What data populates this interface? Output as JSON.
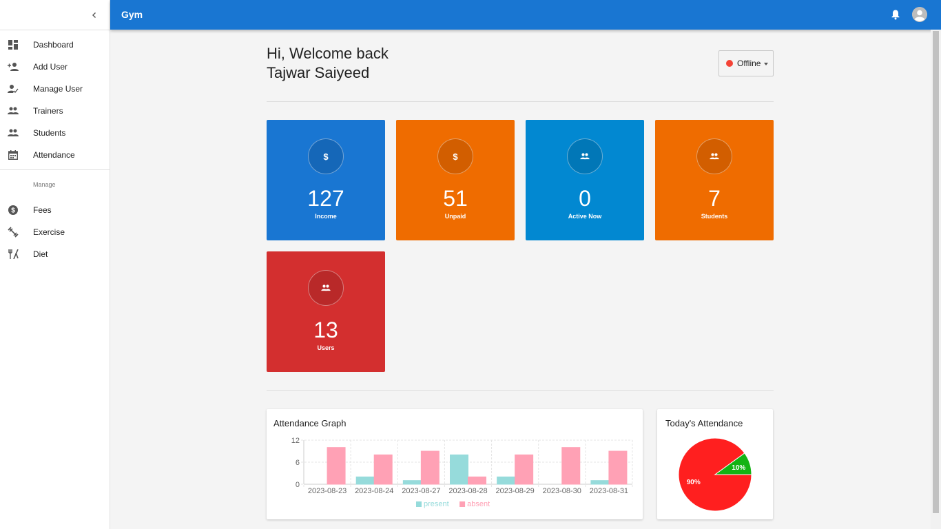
{
  "app": {
    "title": "Gym"
  },
  "sidebar": {
    "items": [
      {
        "label": "Dashboard",
        "icon": "dashboard-icon"
      },
      {
        "label": "Add User",
        "icon": "person-add-icon"
      },
      {
        "label": "Manage User",
        "icon": "person-check-icon"
      },
      {
        "label": "Trainers",
        "icon": "group-icon"
      },
      {
        "label": "Students",
        "icon": "group-icon"
      },
      {
        "label": "Attendance",
        "icon": "calendar-icon"
      }
    ],
    "section_label": "Manage",
    "manage_items": [
      {
        "label": "Fees",
        "icon": "dollar-circle-icon"
      },
      {
        "label": "Exercise",
        "icon": "fitness-icon"
      },
      {
        "label": "Diet",
        "icon": "restaurant-icon"
      }
    ]
  },
  "greeting": {
    "line1": "Hi, Welcome back",
    "line2": "Tajwar Saiyeed"
  },
  "status": {
    "label": "Offline",
    "color": "#f44336"
  },
  "stats": [
    {
      "value": "127",
      "label": "Income",
      "icon": "dollar-icon",
      "color": "#1976d2"
    },
    {
      "value": "51",
      "label": "Unpaid",
      "icon": "dollar-icon",
      "color": "#ef6c00"
    },
    {
      "value": "0",
      "label": "Active Now",
      "icon": "group-icon",
      "color": "#0288d1"
    },
    {
      "value": "7",
      "label": "Students",
      "icon": "group-icon",
      "color": "#ef6c00"
    },
    {
      "value": "13",
      "label": "Users",
      "icon": "group-icon",
      "color": "#d32f2f"
    }
  ],
  "attendance_graph": {
    "title": "Attendance Graph"
  },
  "todays_attendance": {
    "title": "Today's Attendance"
  },
  "chart_data": [
    {
      "type": "bar",
      "title": "Attendance Graph",
      "categories": [
        "2023-08-23",
        "2023-08-24",
        "2023-08-27",
        "2023-08-28",
        "2023-08-29",
        "2023-08-30",
        "2023-08-31"
      ],
      "series": [
        {
          "name": "present",
          "values": [
            0,
            2,
            1,
            8,
            2,
            0,
            1
          ],
          "color": "#96dbdb"
        },
        {
          "name": "absent",
          "values": [
            10,
            8,
            9,
            2,
            8,
            10,
            9
          ],
          "color": "#ffa1b5"
        }
      ],
      "yticks": [
        "0",
        "6",
        "12"
      ],
      "ylim": [
        0,
        12
      ],
      "grid": true,
      "legend": "bottom"
    },
    {
      "type": "pie",
      "title": "Today's Attendance",
      "slices": [
        {
          "label": "90%",
          "value": 90,
          "color": "#ff1f1f"
        },
        {
          "label": "10%",
          "value": 10,
          "color": "#13b313"
        }
      ]
    }
  ]
}
